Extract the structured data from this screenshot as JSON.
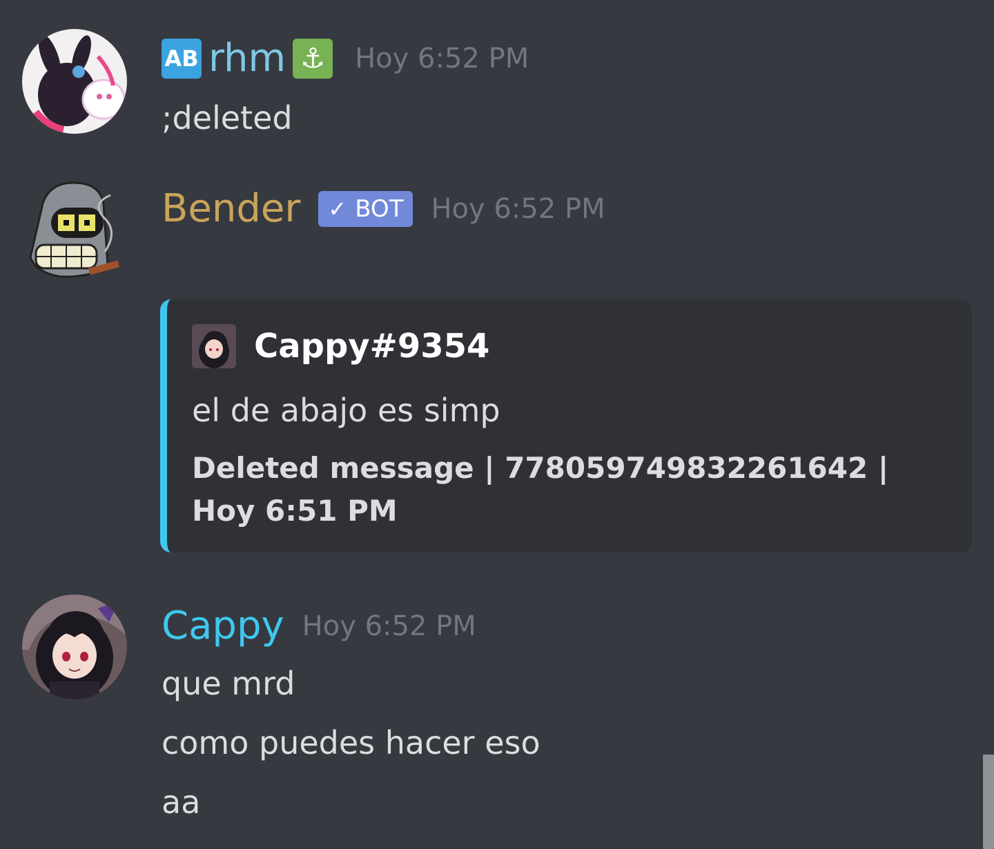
{
  "messages": [
    {
      "username_prefix_emoji": "AB",
      "username": "rhm",
      "username_suffix_emoji": "⚓",
      "timestamp": "Hoy 6:52 PM",
      "lines": [
        ";deleted"
      ],
      "username_color": "#7ec8e3"
    },
    {
      "username": "Bender",
      "badge": "BOT",
      "badge_check": "✓",
      "timestamp": "Hoy 6:52 PM",
      "username_color": "#c9a55a",
      "embed": {
        "author": "Cappy#9354",
        "description": "el de abajo es simp",
        "footer": "Deleted message | 778059749832261642 | Hoy 6:51 PM",
        "accent_color": "#3ec8f0"
      }
    },
    {
      "username": "Cappy",
      "timestamp": "Hoy 6:52 PM",
      "username_color": "#3ec8f0",
      "lines": [
        "que mrd",
        "como puedes hacer eso",
        "aa"
      ]
    }
  ],
  "icons": {
    "avatar1": "avatar-rhm",
    "avatar2": "avatar-bender",
    "avatar3": "avatar-cappy"
  }
}
